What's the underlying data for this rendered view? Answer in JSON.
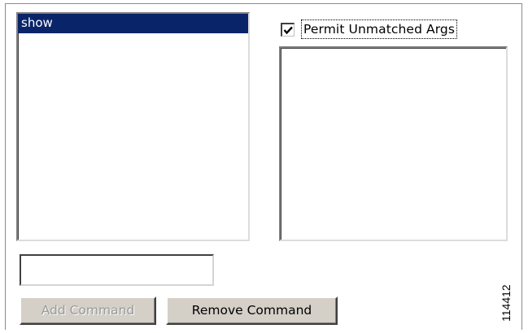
{
  "command_list": {
    "items": [
      {
        "label": "show",
        "selected": true
      }
    ]
  },
  "permit_unmatched_args": {
    "label": "Permit Unmatched Args",
    "checked": true
  },
  "arguments_list": {
    "items": []
  },
  "command_input": {
    "value": ""
  },
  "buttons": {
    "add_command": {
      "label": "Add Command",
      "enabled": false
    },
    "remove_command": {
      "label": "Remove Command",
      "enabled": true
    }
  },
  "figure_id": "114412",
  "colors": {
    "selection_bg": "#0a246a",
    "button_face": "#d4d0c8",
    "disabled_text": "#9a9a9a"
  }
}
